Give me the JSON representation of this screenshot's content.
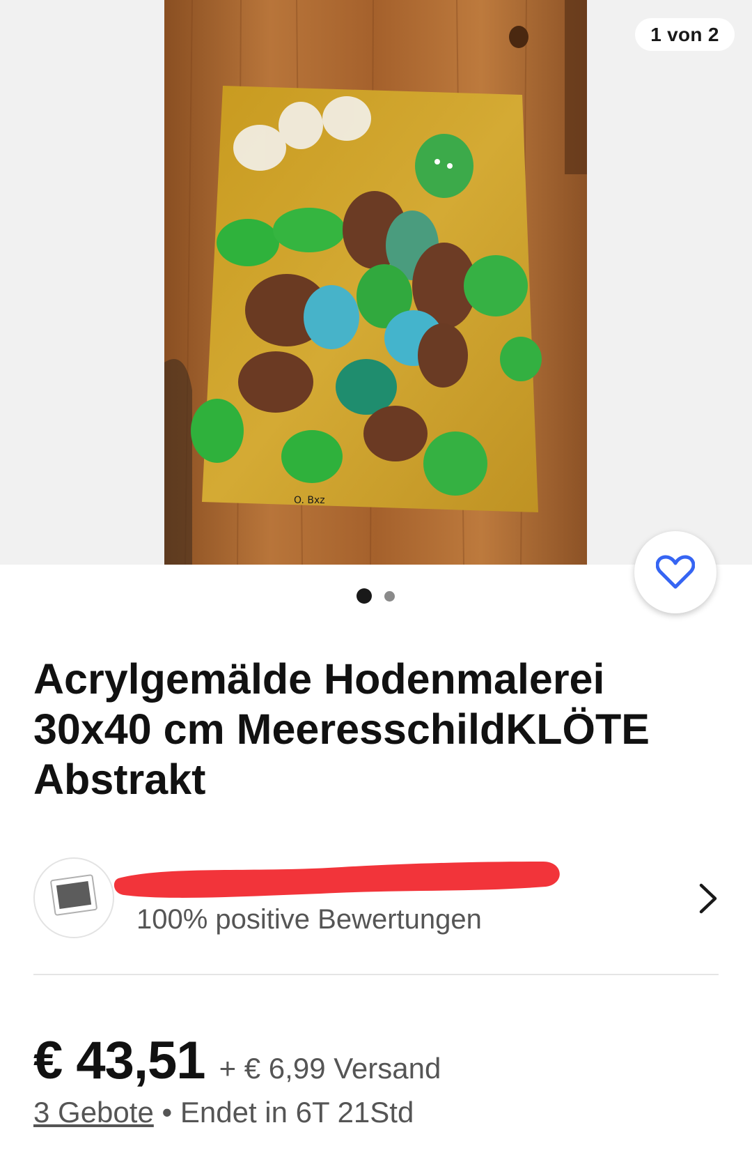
{
  "gallery": {
    "counter": "1 von 2",
    "total_images": 2,
    "active_image": 1,
    "signature": "O. Bxz"
  },
  "listing": {
    "title": "Acrylgemälde Hodenmalerei 30x40 cm MeeresschildKLÖTE Abstrakt"
  },
  "seller": {
    "rating": "100% positive Bewertungen"
  },
  "pricing": {
    "price": "€ 43,51",
    "shipping": "+ € 6,99 Versand",
    "bids": "3 Gebote",
    "ends": "• Endet in 6T 21Std"
  },
  "colors": {
    "accent": "#3665f3",
    "redaction": "#f2343a",
    "canvas_gold": "#c9a027",
    "wood": "#b36f32"
  },
  "icons": {
    "watch": "heart-icon",
    "seller_nav": "chevron-right-icon",
    "avatar": "photo-placeholder-icon"
  }
}
